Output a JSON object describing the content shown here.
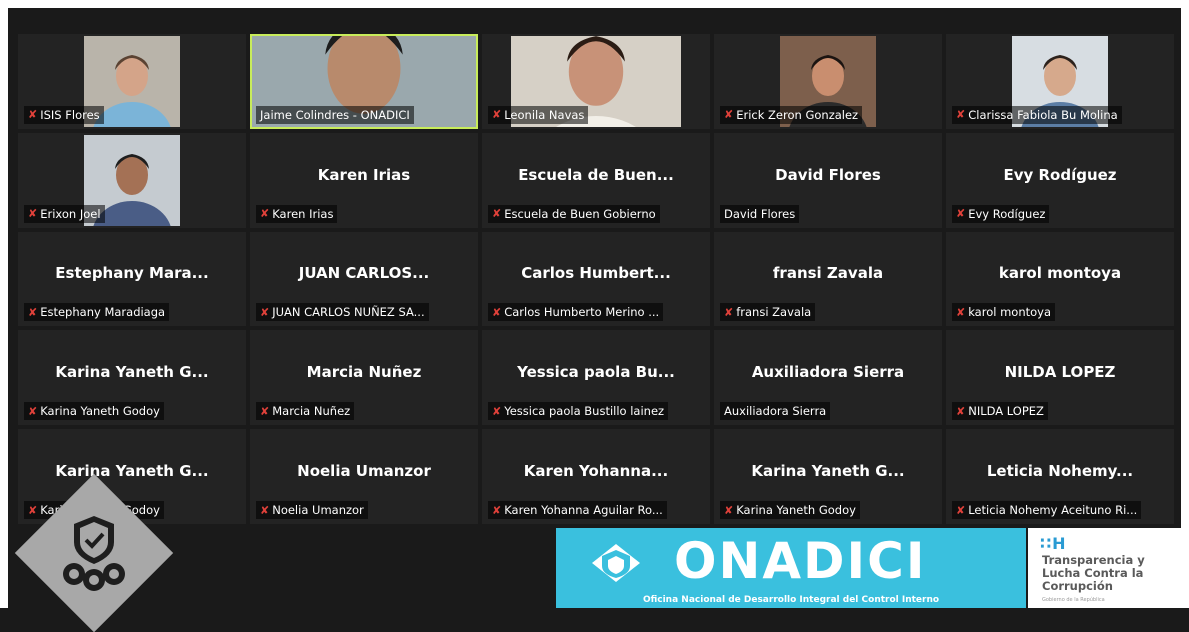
{
  "tiles": [
    {
      "big": "",
      "tag": "ISIS Flores",
      "mic_muted": true,
      "video": "isis"
    },
    {
      "big": "",
      "tag": "Jaime Colindres - ONADICI",
      "mic_muted": false,
      "video": "jaime",
      "active": true
    },
    {
      "big": "",
      "tag": "Leonila Navas",
      "mic_muted": true,
      "video": "leonila"
    },
    {
      "big": "",
      "tag": "Erick Zeron Gonzalez",
      "mic_muted": true,
      "video": "erick"
    },
    {
      "big": "",
      "tag": "Clarissa Fabiola Bu Molina",
      "mic_muted": true,
      "video": "clarissa"
    },
    {
      "big": "",
      "tag": "Erixon Joel",
      "mic_muted": true,
      "video": "erixon"
    },
    {
      "big": "Karen Irias",
      "tag": "Karen Irias",
      "mic_muted": true
    },
    {
      "big": "Escuela de Buen...",
      "tag": "Escuela de Buen Gobierno",
      "mic_muted": true
    },
    {
      "big": "David Flores",
      "tag": "David Flores",
      "mic_muted": false
    },
    {
      "big": "Evy Rodíguez",
      "tag": "Evy Rodíguez",
      "mic_muted": true
    },
    {
      "big": "Estephany Mara...",
      "tag": "Estephany Maradiaga",
      "mic_muted": true
    },
    {
      "big": "JUAN CARLOS...",
      "tag": "JUAN CARLOS NUÑEZ SA...",
      "mic_muted": true
    },
    {
      "big": "Carlos Humbert...",
      "tag": "Carlos Humberto Merino ...",
      "mic_muted": true
    },
    {
      "big": "fransi Zavala",
      "tag": "fransi Zavala",
      "mic_muted": true
    },
    {
      "big": "karol montoya",
      "tag": "karol montoya",
      "mic_muted": true
    },
    {
      "big": "Karina Yaneth G...",
      "tag": "Karina Yaneth Godoy",
      "mic_muted": true
    },
    {
      "big": "Marcia Nuñez",
      "tag": "Marcia Nuñez",
      "mic_muted": true
    },
    {
      "big": "Yessica paola Bu...",
      "tag": "Yessica paola Bustillo lainez",
      "mic_muted": true
    },
    {
      "big": "Auxiliadora Sierra",
      "tag": "Auxiliadora Sierra",
      "mic_muted": false
    },
    {
      "big": "NILDA LOPEZ",
      "tag": "NILDA LOPEZ",
      "mic_muted": true
    },
    {
      "big": "Karina Yaneth G...",
      "tag": "Karina Yaneth Godoy",
      "mic_muted": true
    },
    {
      "big": "Noelia Umanzor",
      "tag": "Noelia Umanzor",
      "mic_muted": true
    },
    {
      "big": "Karen Yohanna...",
      "tag": "Karen Yohanna Aguilar Ro...",
      "mic_muted": true
    },
    {
      "big": "Karina Yaneth G...",
      "tag": "Karina Yaneth Godoy",
      "mic_muted": true
    },
    {
      "big": "Leticia Nohemy...",
      "tag": "Leticia Nohemy Aceituno Ri...",
      "mic_muted": true
    }
  ],
  "banner": {
    "onadici_word": "ONADICI",
    "onadici_sub": "Oficina Nacional de Desarrollo Integral del Control Interno",
    "transp_mark": "∷H",
    "transp_line1": "Transparencia y",
    "transp_line2": "Lucha Contra la",
    "transp_line3": "Corrupción",
    "transp_small": "Gobierno de la República"
  },
  "colors": {
    "active_border": "#c8ec5a",
    "muted_mic": "#e0413a",
    "onadici_blue": "#3ac0de"
  }
}
